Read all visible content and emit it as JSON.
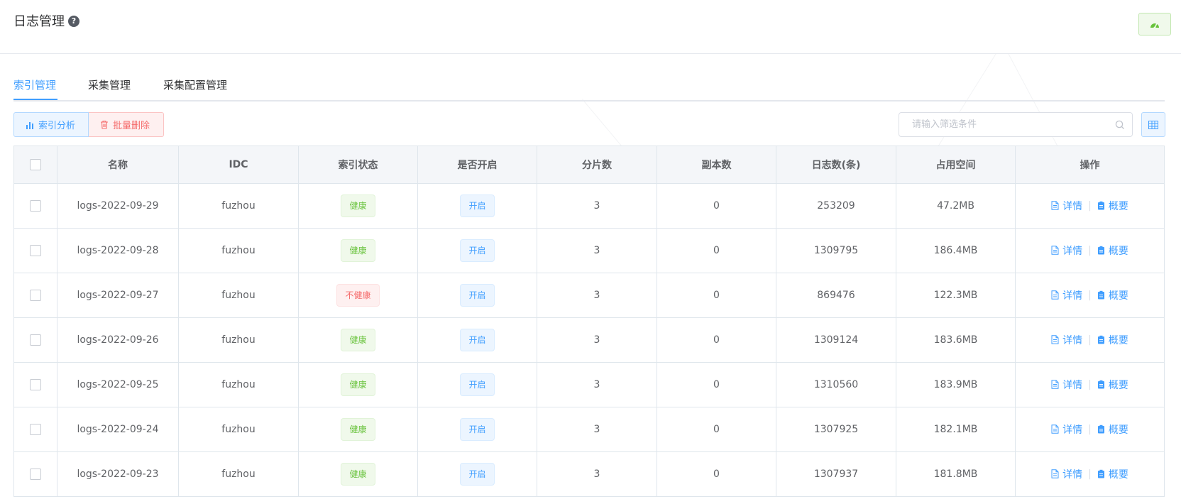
{
  "header": {
    "title": "日志管理",
    "help_icon": "question-circle-icon",
    "dashboard_icon": "dashboard-icon"
  },
  "tabs": [
    {
      "label": "索引管理",
      "active": true
    },
    {
      "label": "采集管理",
      "active": false
    },
    {
      "label": "采集配置管理",
      "active": false
    }
  ],
  "toolbar": {
    "analysis_label": "索引分析",
    "delete_label": "批量删除",
    "search_placeholder": "请输入筛选条件",
    "columns_icon": "table-columns-icon"
  },
  "table": {
    "columns": [
      "名称",
      "IDC",
      "索引状态",
      "是否开启",
      "分片数",
      "副本数",
      "日志数(条)",
      "占用空间",
      "操作"
    ],
    "actions": {
      "detail": "详情",
      "summary": "概要"
    },
    "rows": [
      {
        "name": "logs-2022-09-29",
        "idc": "fuzhou",
        "status": "健康",
        "healthy": true,
        "enabled": "开启",
        "shards": "3",
        "replicas": "0",
        "count": "253209",
        "size": "47.2MB"
      },
      {
        "name": "logs-2022-09-28",
        "idc": "fuzhou",
        "status": "健康",
        "healthy": true,
        "enabled": "开启",
        "shards": "3",
        "replicas": "0",
        "count": "1309795",
        "size": "186.4MB"
      },
      {
        "name": "logs-2022-09-27",
        "idc": "fuzhou",
        "status": "不健康",
        "healthy": false,
        "enabled": "开启",
        "shards": "3",
        "replicas": "0",
        "count": "869476",
        "size": "122.3MB"
      },
      {
        "name": "logs-2022-09-26",
        "idc": "fuzhou",
        "status": "健康",
        "healthy": true,
        "enabled": "开启",
        "shards": "3",
        "replicas": "0",
        "count": "1309124",
        "size": "183.6MB"
      },
      {
        "name": "logs-2022-09-25",
        "idc": "fuzhou",
        "status": "健康",
        "healthy": true,
        "enabled": "开启",
        "shards": "3",
        "replicas": "0",
        "count": "1310560",
        "size": "183.9MB"
      },
      {
        "name": "logs-2022-09-24",
        "idc": "fuzhou",
        "status": "健康",
        "healthy": true,
        "enabled": "开启",
        "shards": "3",
        "replicas": "0",
        "count": "1307925",
        "size": "182.1MB"
      },
      {
        "name": "logs-2022-09-23",
        "idc": "fuzhou",
        "status": "健康",
        "healthy": true,
        "enabled": "开启",
        "shards": "3",
        "replicas": "0",
        "count": "1307937",
        "size": "181.8MB"
      }
    ]
  },
  "colors": {
    "primary": "#409eff",
    "success": "#67c23a",
    "danger": "#f56c6c"
  }
}
